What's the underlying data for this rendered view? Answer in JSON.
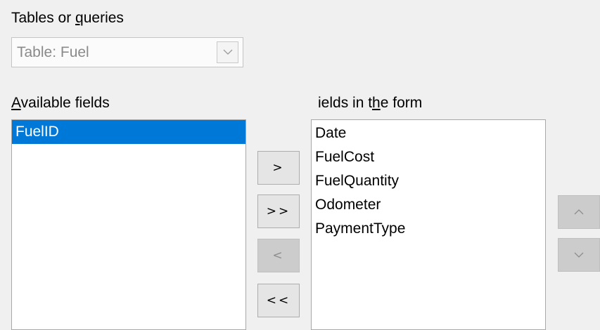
{
  "source": {
    "label": "Tables or queries",
    "selected_value": "Table: Fuel"
  },
  "available": {
    "label": "Available fields",
    "items": [
      "FuelID"
    ],
    "selected_index": 0
  },
  "form_fields": {
    "label": "ields in the form",
    "items": [
      "Date",
      "FuelCost",
      "FuelQuantity",
      "Odometer",
      "PaymentType"
    ]
  },
  "buttons": {
    "add_one": ">",
    "add_all": ">>",
    "remove_one": "<",
    "remove_all": "<<",
    "move_up": "^",
    "move_down": "v"
  },
  "colors": {
    "selection": "#0078d7",
    "disabled_button": "#cccccc"
  }
}
